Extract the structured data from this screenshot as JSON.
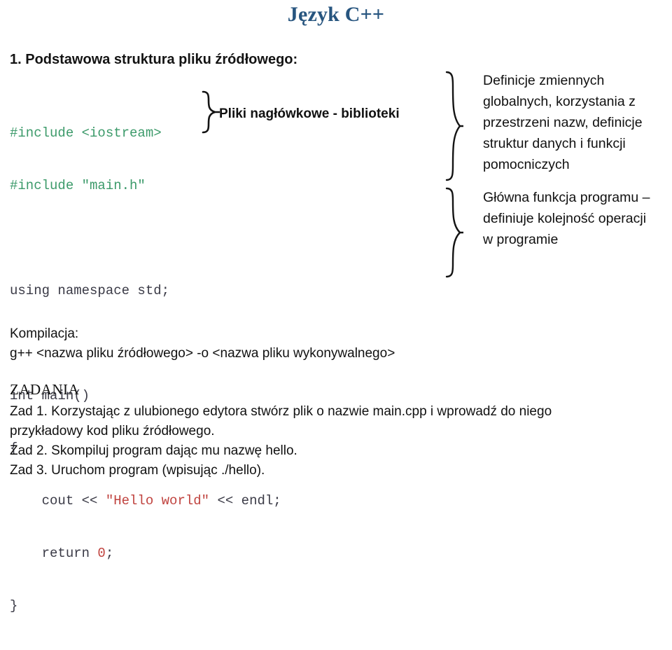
{
  "slide": {
    "title": "Język C++",
    "section_heading": "1. Podstawowa struktura pliku źródłowego:"
  },
  "code": {
    "lines": [
      {
        "type": "preproc",
        "text": "#include <iostream>"
      },
      {
        "type": "preproc",
        "text": "#include \"main.h\""
      },
      {
        "type": "blank",
        "text": ""
      },
      {
        "type": "plain",
        "text": "using namespace std;"
      },
      {
        "type": "blank",
        "text": ""
      },
      {
        "type": "plain",
        "text": "int main()"
      },
      {
        "type": "plain",
        "text": "{"
      },
      {
        "type": "mixed",
        "text": "    cout << \"Hello world\" << endl;"
      },
      {
        "type": "mixed",
        "text": "    return 0;"
      },
      {
        "type": "plain",
        "text": "}"
      }
    ],
    "line_include_1": "#include <iostream>",
    "line_include_2": "#include \"main.h\"",
    "line_using": "using namespace std;",
    "line_int_main": "int main()",
    "line_open_brace": "{",
    "line_cout_pre": "    cout << ",
    "line_cout_string": "\"Hello world\"",
    "line_cout_post": " << endl;",
    "line_return_pre": "    return ",
    "line_return_num": "0",
    "line_return_post": ";",
    "line_close_brace": "}",
    "colors": {
      "preprocessor": "#3C9A6A",
      "string": "#C0433F",
      "number": "#C0433F",
      "plain": "#3A3A46"
    }
  },
  "callouts": {
    "headers": "Pliki nagłówkowe - biblioteki",
    "globals": [
      "Definicje zmiennych",
      "globalnych, korzystania z",
      "przestrzeni nazw, definicje",
      "struktur danych i funkcji",
      "pomocniczych"
    ],
    "main_function": [
      "Główna funkcja programu –",
      "definiuje kolejność operacji",
      "w programie"
    ]
  },
  "compilation": {
    "label": "Kompilacja:",
    "command": "g++ <nazwa pliku źródłowego> -o <nazwa pliku wykonywalnego>"
  },
  "tasks": {
    "heading": "ZADANIA",
    "items": [
      "Zad 1. Korzystając z ulubionego edytora stwórz plik o nazwie main.cpp i wprowadź do niego",
      "przykładowy kod pliku źródłowego.",
      "Zad 2. Skompiluj program dając mu nazwę hello.",
      "Zad 3. Uruchom program (wpisując ./hello)."
    ]
  },
  "theme": {
    "title_color": "#27557F",
    "text_color": "#111111",
    "background": "#ffffff"
  }
}
